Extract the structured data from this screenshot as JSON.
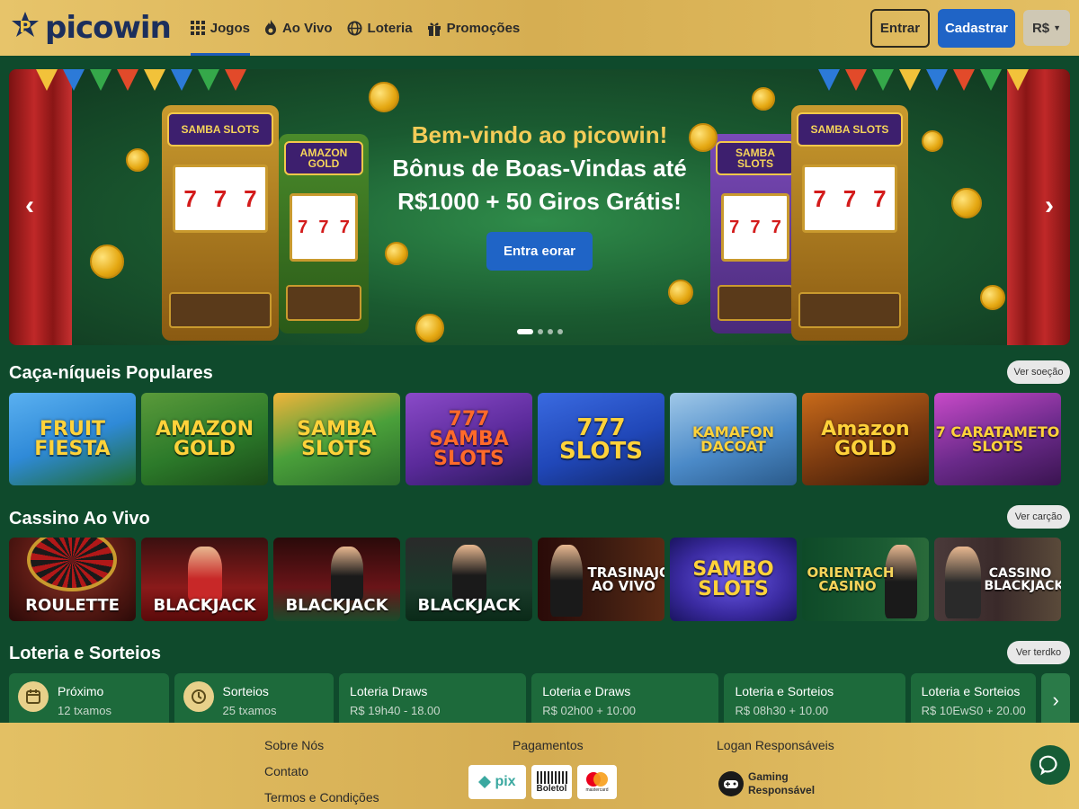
{
  "header": {
    "brand": "picowin",
    "nav": [
      {
        "label": "Jogos",
        "icon": "grid-icon",
        "active": true
      },
      {
        "label": "Ao Vivo",
        "icon": "flame-icon"
      },
      {
        "label": "Loteria",
        "icon": "globe-icon"
      },
      {
        "label": "Promoções",
        "icon": "gift-icon"
      }
    ],
    "login_label": "Entrar",
    "register_label": "Cadastrar",
    "currency": "R$"
  },
  "hero": {
    "line1": "Bem-vindo ao picowin!",
    "line2": "Bônus de Boas-Vindas até",
    "line3": "R$1000 + 50 Giros Grátis!",
    "cta_label": "Entra eorar",
    "slot_labels": [
      "SAMBA SLOTS",
      "AMAZON GOLD",
      "SAMBA SLOTS",
      "SAMBA SLOTS"
    ],
    "reel_symbol": "7",
    "slides_total": 4,
    "active_slide": 1
  },
  "slots_section": {
    "title": "Caça-níqueis Populares",
    "view_all_label": "Ver soeção",
    "games": [
      {
        "title": "FRUIT FIESTA",
        "bg": "#2f8ad8"
      },
      {
        "title": "AMAZON GOLD",
        "bg": "#2c7a2a"
      },
      {
        "title": "SAMBA SLOTS",
        "bg": "#4aa03a"
      },
      {
        "title": "777 SAMBA SLOTS",
        "bg": "#5a2a9a"
      },
      {
        "title": "777 SLOTS",
        "bg": "#2047b8"
      },
      {
        "title": "KAMAFON DACOAT",
        "bg": "#4b8ac8"
      },
      {
        "title": "Amazon GOLD",
        "bg": "#7a3a10"
      },
      {
        "title": "7 CARATAMETO SLOTS",
        "bg": "#6a2a8a"
      }
    ]
  },
  "live_section": {
    "title": "Cassino Ao Vivo",
    "view_all_label": "Ver carção",
    "games": [
      {
        "title": "ROULETTE",
        "bg": "#5a1a14"
      },
      {
        "title": "BLACKJACK",
        "bg": "#8a1a1a"
      },
      {
        "title": "BLACKJACK",
        "bg": "#6a1418"
      },
      {
        "title": "BLACKJACK",
        "bg": "#1a3a2a"
      },
      {
        "title": "TRASINAJO AO VIVO",
        "bg": "#3a1a10"
      },
      {
        "title": "SAMBO SLOTS",
        "bg": "#3a2aa0"
      },
      {
        "title": "ORIENTACH CASINO",
        "bg": "#1a5a32"
      },
      {
        "title": "CASSINO BLACKJACK",
        "bg": "#3a2a2a"
      }
    ]
  },
  "lottery_section": {
    "title": "Loteria e Sorteios",
    "view_all_label": "Ver terdko",
    "items": [
      {
        "title": "Próximo",
        "sub": "12 txamos",
        "icon": "calendar-icon"
      },
      {
        "title": "Sorteios",
        "sub": "25 txamos",
        "icon": "clock-icon"
      },
      {
        "title": "Loteria Draws",
        "sub": "R$ 19h40 - 18.00"
      },
      {
        "title": "Loteria e Draws",
        "sub": "R$ 02h00 + 10:00"
      },
      {
        "title": "Loteria e Sorteios",
        "sub": "R$ 08h30 + 10.00"
      },
      {
        "title": "Loteria e Sorteios",
        "sub": "R$ 10EwS0 + 20.00"
      }
    ]
  },
  "footer": {
    "links": [
      "Sobre Nós",
      "Contato",
      "Termos e Condições"
    ],
    "payments_title": "Pagamentos",
    "payments": [
      "pix",
      "Boletol",
      "mastercard"
    ],
    "responsible_title": "Logan Responsáveis",
    "responsible_badge": "Gaming Responsável"
  },
  "colors": {
    "gold": "#e3c064",
    "dark_green": "#0f4a2c",
    "primary_blue": "#1f64c6",
    "brand_navy": "#1c2f5c"
  }
}
